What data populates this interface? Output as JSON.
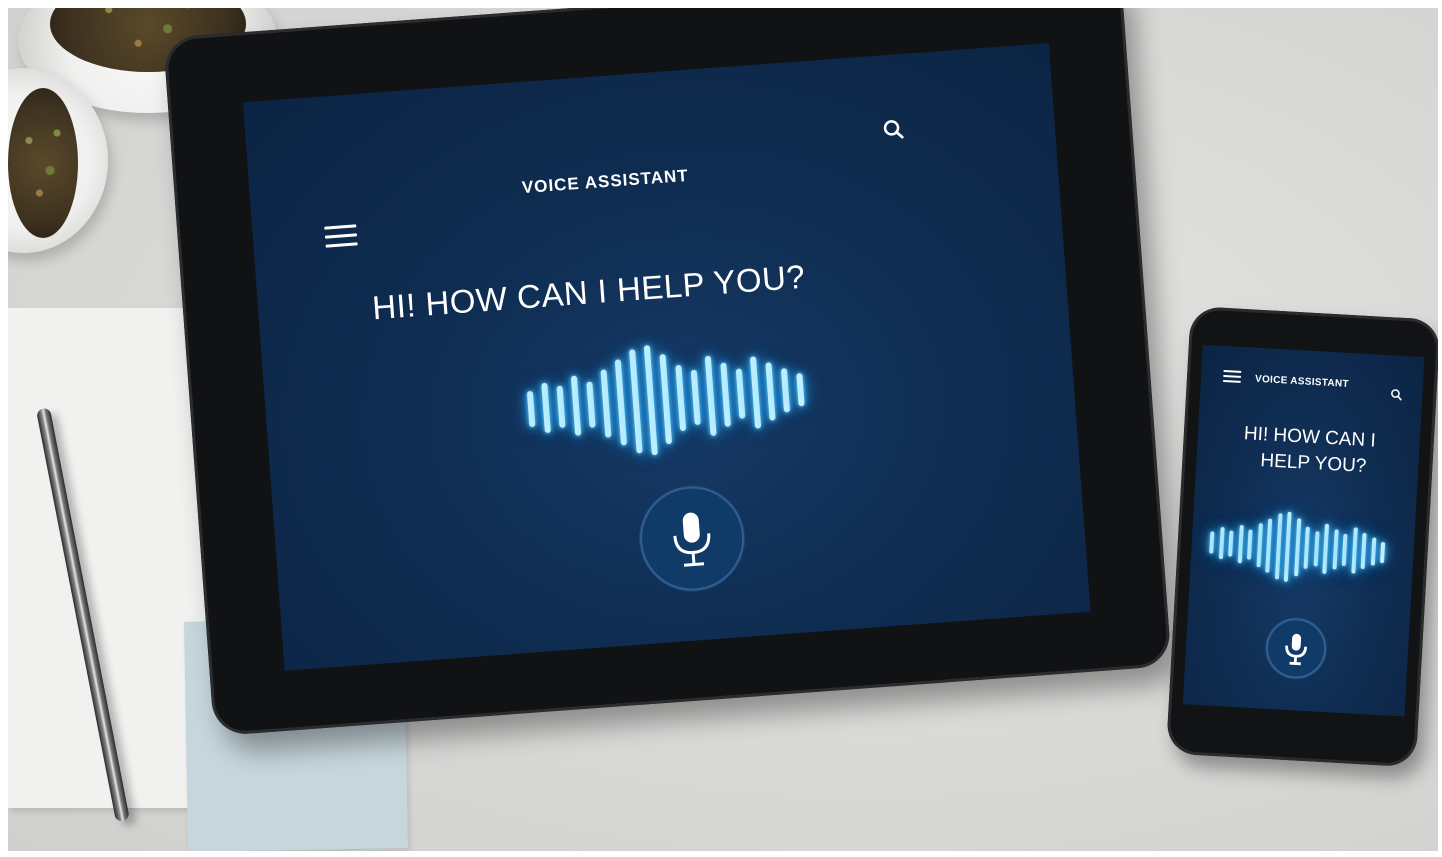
{
  "tablet": {
    "header_title": "VOICE ASSISTANT",
    "greeting": "HI! HOW CAN I HELP YOU?",
    "icons": [
      "menu-icon",
      "search-icon",
      "microphone-icon"
    ]
  },
  "phone": {
    "header_title": "VOICE ASSISTANT",
    "greeting_line1": "HI! HOW CAN I",
    "greeting_line2": "HELP YOU?",
    "icons": [
      "menu-icon",
      "search-icon",
      "microphone-icon"
    ]
  },
  "colors": {
    "screen_bg": "#0f2d52",
    "wave_glow": "#29a9ff",
    "text": "#ffffff"
  }
}
